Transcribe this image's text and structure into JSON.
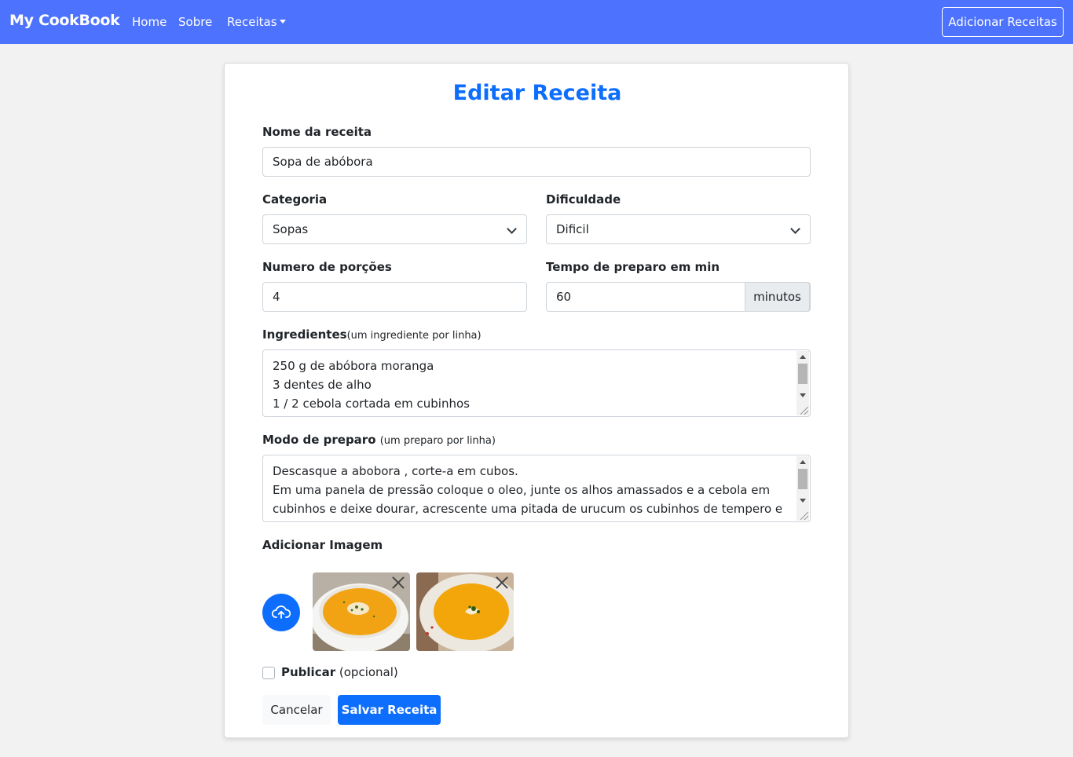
{
  "navbar": {
    "brand": "My CookBook",
    "links": [
      "Home",
      "Sobre",
      "Receitas"
    ],
    "add_button": "Adicionar Receitas"
  },
  "form": {
    "title": "Editar Receita",
    "name_label": "Nome da receita",
    "name_value": "Sopa de abóbora",
    "category_label": "Categoria",
    "category_value": "Sopas",
    "difficulty_label": "Dificuldade",
    "difficulty_value": "Dificil",
    "portions_label": "Numero de porções",
    "portions_value": "4",
    "time_label": "Tempo de preparo em min",
    "time_value": "60",
    "time_suffix": "minutos",
    "ingredients_label": "Ingredientes",
    "ingredients_hint": "(um ingrediente por linha)",
    "ingredients_lines": [
      "250 g de abóbora moranga",
      "3 dentes de alho",
      "1 / 2 cebola cortada em cubinhos"
    ],
    "method_label": "Modo de preparo",
    "method_hint": "(um preparo por linha)",
    "method_lines": [
      "Descasque a abobora , corte-a em cubos.",
      "Em uma panela de pressão coloque o oleo, junte os alhos amassados e a cebola em",
      "cubinhos e deixe dourar, acrescente uma pitada de urucum os cubinhos de tempero e"
    ],
    "image_label": "Adicionar Imagem",
    "images": [
      "pumpkin-soup-photo-1",
      "pumpkin-soup-photo-2"
    ],
    "publish_label": "Publicar",
    "publish_hint": "(opcional)",
    "publish_checked": false,
    "cancel_label": "Cancelar",
    "save_label": "Salvar Receita"
  },
  "colors": {
    "navbar": "#4d72fe",
    "primary": "#0d6efd"
  }
}
